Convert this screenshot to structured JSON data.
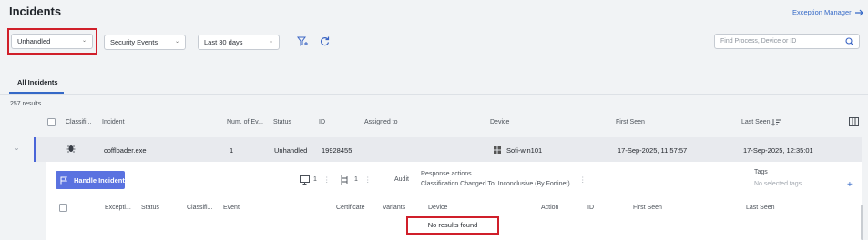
{
  "page": {
    "title": "Incidents",
    "exception_link": "Exception Manager"
  },
  "filters": {
    "status_value": "Unhandled",
    "event_type_value": "Security Events",
    "time_range_value": "Last 30 days",
    "search_placeholder": "Find Process, Device or ID"
  },
  "tabs": [
    {
      "label": "All Incidents"
    }
  ],
  "results_count": "257 results",
  "table": {
    "columns": [
      "Classifi...",
      "Incident",
      "Num. of Ev...",
      "Status",
      "ID",
      "Assigned to",
      "Device",
      "First Seen",
      "Last Seen"
    ]
  },
  "row": {
    "incident": "coffloader.exe",
    "num_events": "1",
    "status": "Unhandled",
    "id": "19928455",
    "device": "Sofi-win101",
    "first_seen": "17-Sep-2025, 11:57:57",
    "last_seen": "17-Sep-2025, 12:35:01"
  },
  "detail": {
    "handle_button": "Handle Incident",
    "devices_count": "1",
    "processes_count": "1",
    "audit_label": "Audit",
    "response_actions_label": "Response actions",
    "response_action_text": "Classification Changed To: Inconclusive (By Fortinet)",
    "tags_label": "Tags",
    "tags_empty": "No selected tags",
    "add_tag": "+"
  },
  "subtable": {
    "columns": [
      "Excepti...",
      "Status",
      "Classifi...",
      "Event",
      "Certificate",
      "Variants",
      "Device",
      "Action",
      "ID",
      "First Seen",
      "Last Seen"
    ],
    "empty_text": "No results found"
  },
  "colors": {
    "accent": "#3569c7",
    "button": "#5a72e0",
    "highlight": "#d01f2a"
  }
}
